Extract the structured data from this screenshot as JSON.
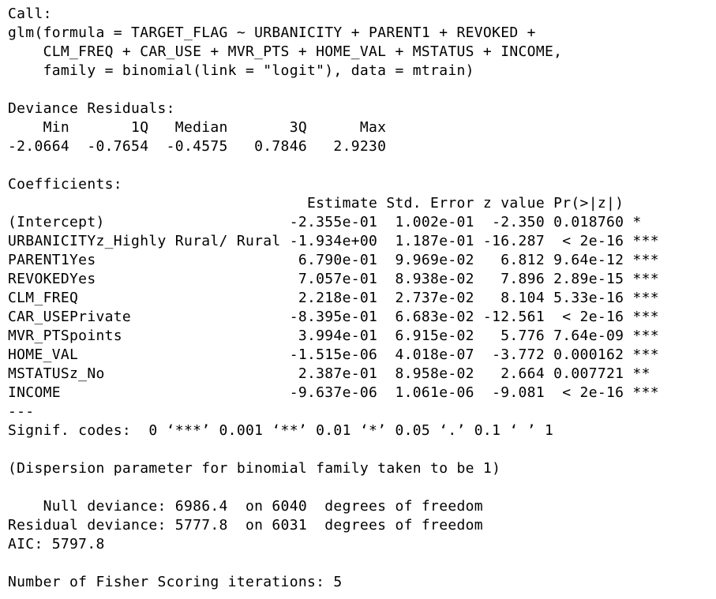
{
  "console": {
    "lines": [
      "Call:",
      "glm(formula = TARGET_FLAG ~ URBANICITY + PARENT1 + REVOKED +",
      "    CLM_FREQ + CAR_USE + MVR_PTS + HOME_VAL + MSTATUS + INCOME,",
      "    family = binomial(link = \"logit\"), data = mtrain)",
      "",
      "Deviance Residuals:",
      "    Min       1Q   Median       3Q      Max",
      "-2.0664  -0.7654  -0.4575   0.7846   2.9230",
      "",
      "Coefficients:",
      "                                  Estimate Std. Error z value Pr(>|z|)",
      "(Intercept)                     -2.355e-01  1.002e-01  -2.350 0.018760 *",
      "URBANICITYz_Highly Rural/ Rural -1.934e+00  1.187e-01 -16.287  < 2e-16 ***",
      "PARENT1Yes                       6.790e-01  9.969e-02   6.812 9.64e-12 ***",
      "REVOKEDYes                       7.057e-01  8.938e-02   7.896 2.89e-15 ***",
      "CLM_FREQ                         2.218e-01  2.737e-02   8.104 5.33e-16 ***",
      "CAR_USEPrivate                  -8.395e-01  6.683e-02 -12.561  < 2e-16 ***",
      "MVR_PTSpoints                    3.994e-01  6.915e-02   5.776 7.64e-09 ***",
      "HOME_VAL                        -1.515e-06  4.018e-07  -3.772 0.000162 ***",
      "MSTATUSz_No                      2.387e-01  8.958e-02   2.664 0.007721 **",
      "INCOME                          -9.637e-06  1.061e-06  -9.081  < 2e-16 ***",
      "---",
      "Signif. codes:  0 ‘***’ 0.001 ‘**’ 0.01 ‘*’ 0.05 ‘.’ 0.1 ‘ ’ 1",
      "",
      "(Dispersion parameter for binomial family taken to be 1)",
      "",
      "    Null deviance: 6986.4  on 6040  degrees of freedom",
      "Residual deviance: 5777.8  on 6031  degrees of freedom",
      "AIC: 5797.8",
      "",
      "Number of Fisher Scoring iterations: 5"
    ]
  }
}
